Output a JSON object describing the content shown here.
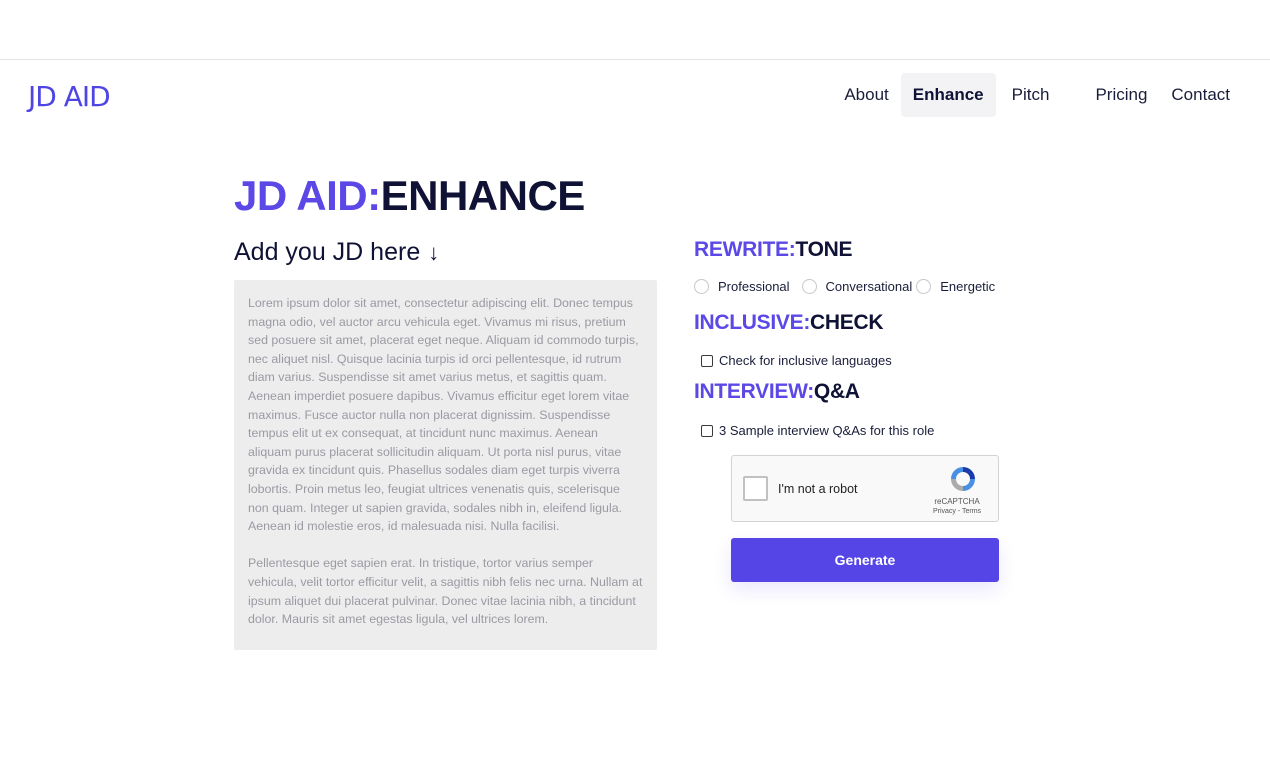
{
  "brand": {
    "logo": "JD AID"
  },
  "nav": {
    "items": [
      {
        "label": "About",
        "active": false
      },
      {
        "label": "Enhance",
        "active": true
      },
      {
        "label": "Pitch",
        "active": false
      },
      {
        "label": "Pricing",
        "active": false
      },
      {
        "label": "Contact",
        "active": false
      }
    ]
  },
  "page": {
    "title_accent": "JD AID:",
    "title_main": "ENHANCE"
  },
  "jd": {
    "label": "Add you JD here",
    "arrow_icon": "arrow-down-icon",
    "paragraphs": [
      "Lorem ipsum dolor sit amet, consectetur adipiscing elit. Donec tempus magna odio, vel auctor arcu vehicula eget. Vivamus mi risus, pretium sed posuere sit amet, placerat eget neque. Aliquam id commodo turpis, nec aliquet nisl. Quisque lacinia turpis id orci pellentesque, id rutrum diam varius. Suspendisse sit amet varius metus, et sagittis quam. Aenean imperdiet posuere dapibus. Vivamus efficitur eget lorem vitae maximus. Fusce auctor nulla non placerat dignissim. Suspendisse tempus elit ut ex consequat, at tincidunt nunc maximus. Aenean aliquam purus placerat sollicitudin aliquam. Ut porta nisl purus, vitae gravida ex tincidunt quis. Phasellus sodales diam eget turpis viverra lobortis. Proin metus leo, feugiat ultrices venenatis quis, scelerisque non quam. Integer ut sapien gravida, sodales nibh in, eleifend ligula. Aenean id molestie eros, id malesuada nisi. Nulla facilisi.",
      "Pellentesque eget sapien erat. In tristique, tortor varius semper vehicula, velit tortor efficitur velit, a sagittis nibh felis nec urna. Nullam at ipsum aliquet dui placerat pulvinar. Donec vitae lacinia nibh, a tincidunt dolor. Mauris sit amet egestas ligula, vel ultrices lorem."
    ]
  },
  "tone": {
    "heading_accent": "REWRITE:",
    "heading_main": "TONE",
    "options": [
      "Professional",
      "Conversational",
      "Energetic"
    ]
  },
  "inclusive": {
    "heading_accent": "INCLUSIVE:",
    "heading_main": "CHECK",
    "checkbox_label": "Check for inclusive languages"
  },
  "interview": {
    "heading_accent": "INTERVIEW:",
    "heading_main": "Q&A",
    "checkbox_label": "3 Sample interview Q&As for this role"
  },
  "recaptcha": {
    "label": "I'm not a robot",
    "brand": "reCAPTCHA",
    "links": "Privacy - Terms"
  },
  "generate": {
    "label": "Generate"
  },
  "colors": {
    "accent": "#5b48e6",
    "dark": "#0f1235",
    "button": "#5645e6",
    "jd_box": "#ededee"
  }
}
